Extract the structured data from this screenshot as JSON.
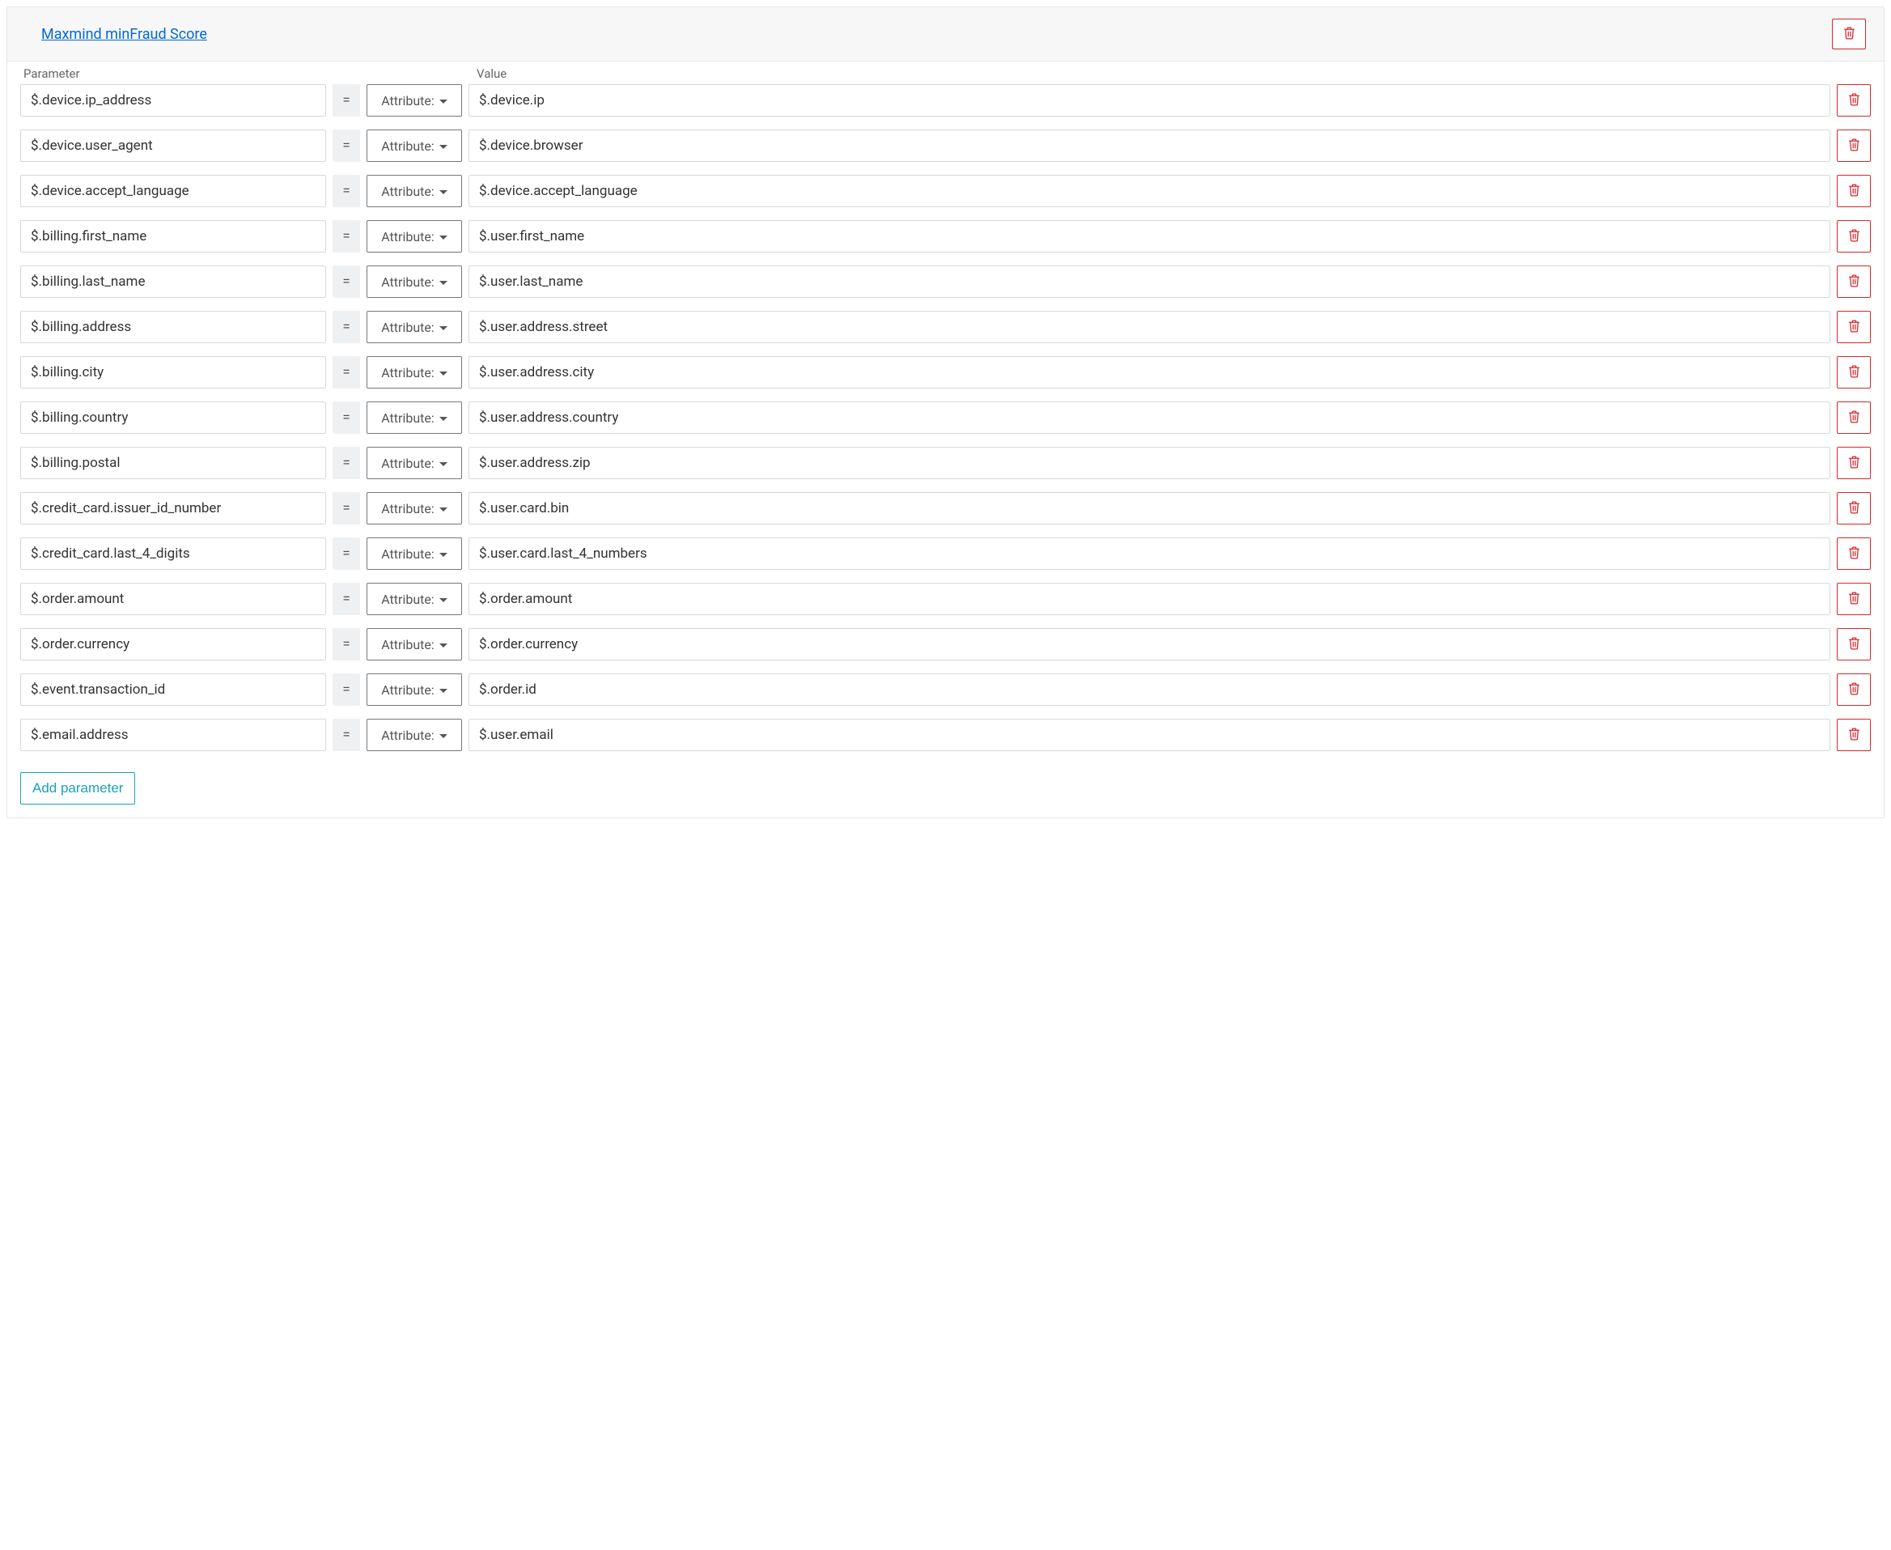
{
  "panel": {
    "title": "Maxmind minFraud Score"
  },
  "headers": {
    "parameter": "Parameter",
    "value": "Value"
  },
  "equals": "=",
  "dropdown_label": "Attribute:",
  "add_parameter_label": "Add parameter",
  "rows": [
    {
      "param": "$.device.ip_address",
      "value": "$.device.ip"
    },
    {
      "param": "$.device.user_agent",
      "value": "$.device.browser"
    },
    {
      "param": "$.device.accept_language",
      "value": "$.device.accept_language"
    },
    {
      "param": "$.billing.first_name",
      "value": "$.user.first_name"
    },
    {
      "param": "$.billing.last_name",
      "value": "$.user.last_name"
    },
    {
      "param": "$.billing.address",
      "value": "$.user.address.street"
    },
    {
      "param": "$.billing.city",
      "value": "$.user.address.city"
    },
    {
      "param": "$.billing.country",
      "value": "$.user.address.country"
    },
    {
      "param": "$.billing.postal",
      "value": "$.user.address.zip"
    },
    {
      "param": "$.credit_card.issuer_id_number",
      "value": "$.user.card.bin"
    },
    {
      "param": "$.credit_card.last_4_digits",
      "value": "$.user.card.last_4_numbers"
    },
    {
      "param": "$.order.amount",
      "value": "$.order.amount"
    },
    {
      "param": "$.order.currency",
      "value": "$.order.currency"
    },
    {
      "param": "$.event.transaction_id",
      "value": "$.order.id"
    },
    {
      "param": "$.email.address",
      "value": "$.user.email"
    }
  ]
}
